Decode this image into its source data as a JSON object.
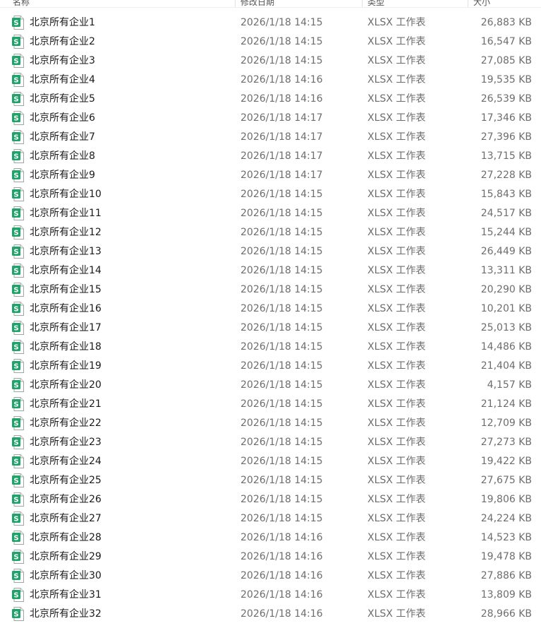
{
  "columns": {
    "name": "名称",
    "date": "修改日期",
    "type": "类型",
    "size": "大小"
  },
  "icon": "xlsx-spreadsheet-icon",
  "icon_glyph": "S",
  "accent_color": "#20a36b",
  "files": [
    {
      "name": "北京所有企业1",
      "date": "2026/1/18 14:15",
      "type": "XLSX 工作表",
      "size": "26,883 KB"
    },
    {
      "name": "北京所有企业2",
      "date": "2026/1/18 14:15",
      "type": "XLSX 工作表",
      "size": "16,547 KB"
    },
    {
      "name": "北京所有企业3",
      "date": "2026/1/18 14:15",
      "type": "XLSX 工作表",
      "size": "27,085 KB"
    },
    {
      "name": "北京所有企业4",
      "date": "2026/1/18 14:16",
      "type": "XLSX 工作表",
      "size": "19,535 KB"
    },
    {
      "name": "北京所有企业5",
      "date": "2026/1/18 14:16",
      "type": "XLSX 工作表",
      "size": "26,539 KB"
    },
    {
      "name": "北京所有企业6",
      "date": "2026/1/18 14:17",
      "type": "XLSX 工作表",
      "size": "17,346 KB"
    },
    {
      "name": "北京所有企业7",
      "date": "2026/1/18 14:17",
      "type": "XLSX 工作表",
      "size": "27,396 KB"
    },
    {
      "name": "北京所有企业8",
      "date": "2026/1/18 14:17",
      "type": "XLSX 工作表",
      "size": "13,715 KB"
    },
    {
      "name": "北京所有企业9",
      "date": "2026/1/18 14:17",
      "type": "XLSX 工作表",
      "size": "27,228 KB"
    },
    {
      "name": "北京所有企业10",
      "date": "2026/1/18 14:15",
      "type": "XLSX 工作表",
      "size": "15,843 KB"
    },
    {
      "name": "北京所有企业11",
      "date": "2026/1/18 14:15",
      "type": "XLSX 工作表",
      "size": "24,517 KB"
    },
    {
      "name": "北京所有企业12",
      "date": "2026/1/18 14:15",
      "type": "XLSX 工作表",
      "size": "15,244 KB"
    },
    {
      "name": "北京所有企业13",
      "date": "2026/1/18 14:15",
      "type": "XLSX 工作表",
      "size": "26,449 KB"
    },
    {
      "name": "北京所有企业14",
      "date": "2026/1/18 14:15",
      "type": "XLSX 工作表",
      "size": "13,311 KB"
    },
    {
      "name": "北京所有企业15",
      "date": "2026/1/18 14:15",
      "type": "XLSX 工作表",
      "size": "20,290 KB"
    },
    {
      "name": "北京所有企业16",
      "date": "2026/1/18 14:15",
      "type": "XLSX 工作表",
      "size": "10,201 KB"
    },
    {
      "name": "北京所有企业17",
      "date": "2026/1/18 14:15",
      "type": "XLSX 工作表",
      "size": "25,013 KB"
    },
    {
      "name": "北京所有企业18",
      "date": "2026/1/18 14:15",
      "type": "XLSX 工作表",
      "size": "14,486 KB"
    },
    {
      "name": "北京所有企业19",
      "date": "2026/1/18 14:15",
      "type": "XLSX 工作表",
      "size": "21,404 KB"
    },
    {
      "name": "北京所有企业20",
      "date": "2026/1/18 14:15",
      "type": "XLSX 工作表",
      "size": "4,157 KB"
    },
    {
      "name": "北京所有企业21",
      "date": "2026/1/18 14:15",
      "type": "XLSX 工作表",
      "size": "21,124 KB"
    },
    {
      "name": "北京所有企业22",
      "date": "2026/1/18 14:15",
      "type": "XLSX 工作表",
      "size": "12,709 KB"
    },
    {
      "name": "北京所有企业23",
      "date": "2026/1/18 14:15",
      "type": "XLSX 工作表",
      "size": "27,273 KB"
    },
    {
      "name": "北京所有企业24",
      "date": "2026/1/18 14:15",
      "type": "XLSX 工作表",
      "size": "19,422 KB"
    },
    {
      "name": "北京所有企业25",
      "date": "2026/1/18 14:15",
      "type": "XLSX 工作表",
      "size": "27,675 KB"
    },
    {
      "name": "北京所有企业26",
      "date": "2026/1/18 14:15",
      "type": "XLSX 工作表",
      "size": "19,806 KB"
    },
    {
      "name": "北京所有企业27",
      "date": "2026/1/18 14:15",
      "type": "XLSX 工作表",
      "size": "24,224 KB"
    },
    {
      "name": "北京所有企业28",
      "date": "2026/1/18 14:16",
      "type": "XLSX 工作表",
      "size": "14,523 KB"
    },
    {
      "name": "北京所有企业29",
      "date": "2026/1/18 14:16",
      "type": "XLSX 工作表",
      "size": "19,478 KB"
    },
    {
      "name": "北京所有企业30",
      "date": "2026/1/18 14:16",
      "type": "XLSX 工作表",
      "size": "27,886 KB"
    },
    {
      "name": "北京所有企业31",
      "date": "2026/1/18 14:16",
      "type": "XLSX 工作表",
      "size": "13,809 KB"
    },
    {
      "name": "北京所有企业32",
      "date": "2026/1/18 14:16",
      "type": "XLSX 工作表",
      "size": "28,966 KB"
    }
  ]
}
